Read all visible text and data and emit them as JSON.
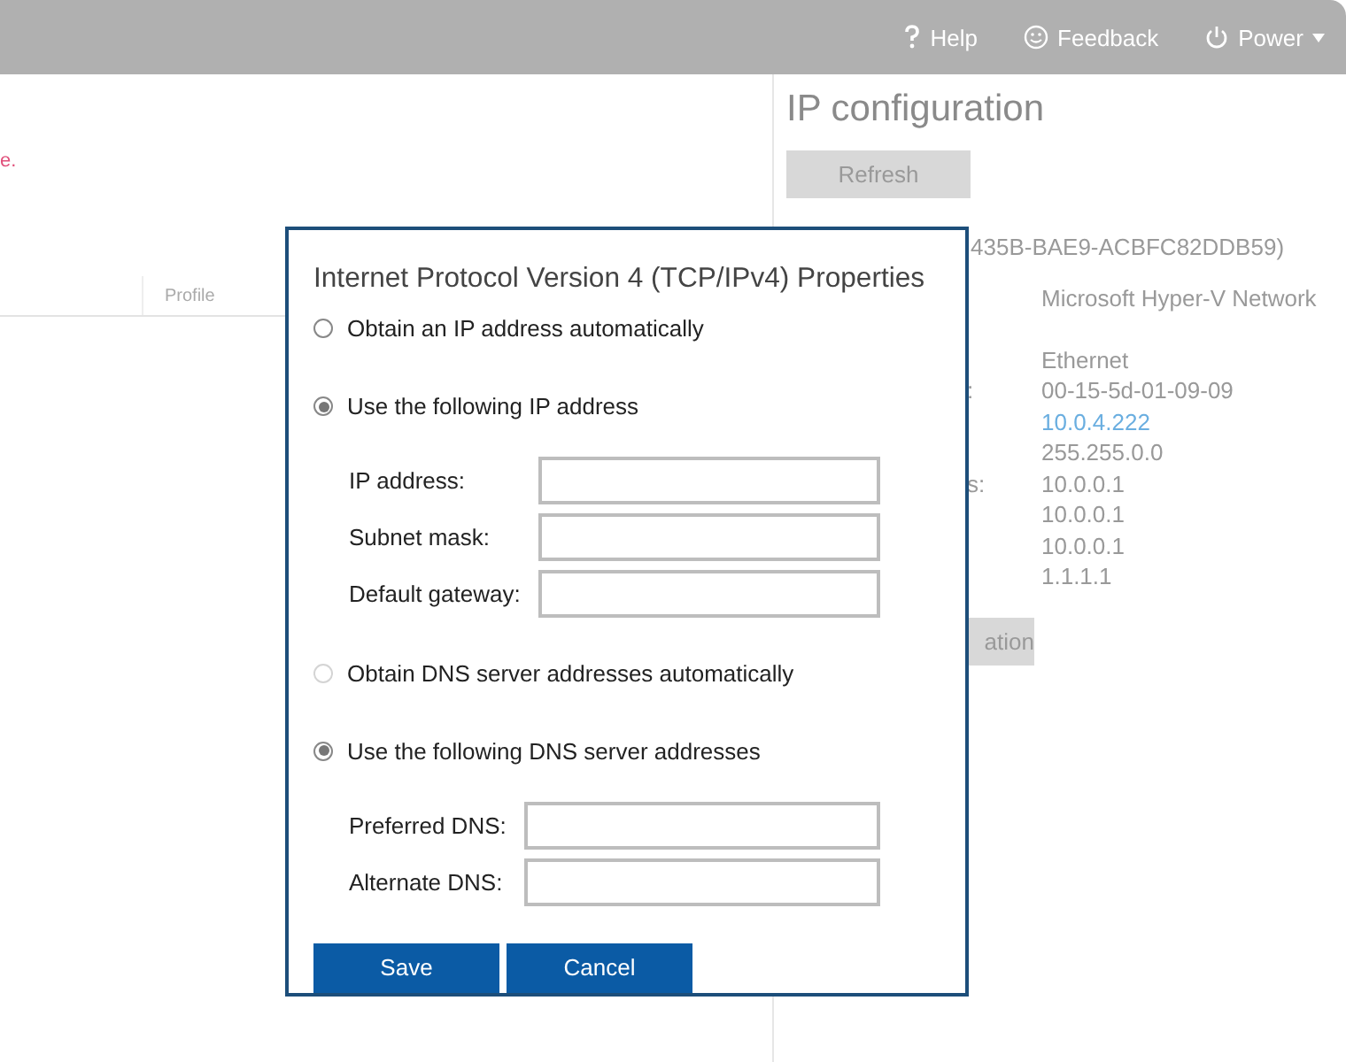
{
  "header": {
    "items": [
      {
        "kind": "help",
        "label": "Help"
      },
      {
        "kind": "feedback",
        "label": "Feedback"
      },
      {
        "kind": "power",
        "label": "Power",
        "menu": true
      }
    ]
  },
  "main": {
    "message": "e.",
    "columns": [
      {
        "label": "Profile"
      }
    ]
  },
  "ip_configuration": {
    "title": "IP configuration",
    "refresh_button": "Refresh",
    "adapter_id": "435B-BAE9-ACBFC82DDB59)",
    "rows": [
      {
        "value": "Microsoft Hyper-V Network"
      },
      {
        "value": "Ethernet"
      },
      {
        "label": ":",
        "value": "00-15-5d-01-09-09"
      },
      {
        "value": "10.0.4.222",
        "link": true
      },
      {
        "value": "255.255.0.0"
      },
      {
        "label": "s:",
        "value": "10.0.0.1"
      },
      {
        "value": "10.0.0.1"
      },
      {
        "value": "10.0.0.1"
      },
      {
        "value": "1.1.1.1"
      }
    ],
    "action_button": "ation"
  },
  "dialog": {
    "title": "Internet Protocol Version 4 (TCP/IPv4) Properties",
    "options": [
      {
        "label": "Obtain an IP address automatically",
        "selected": false,
        "disabled": false
      },
      {
        "label": "Use the following IP address",
        "selected": true,
        "disabled": false,
        "fields": [
          {
            "label": "IP address:"
          },
          {
            "label": "Subnet mask:"
          },
          {
            "label": "Default gateway:"
          }
        ]
      },
      {
        "label": "Obtain DNS server addresses automatically",
        "selected": false,
        "disabled": true
      },
      {
        "label": "Use the following DNS server addresses",
        "selected": true,
        "disabled": false,
        "fields": [
          {
            "label": "Preferred DNS:"
          },
          {
            "label": "Alternate DNS:"
          }
        ]
      }
    ],
    "buttons": [
      "Save",
      "Cancel"
    ]
  }
}
